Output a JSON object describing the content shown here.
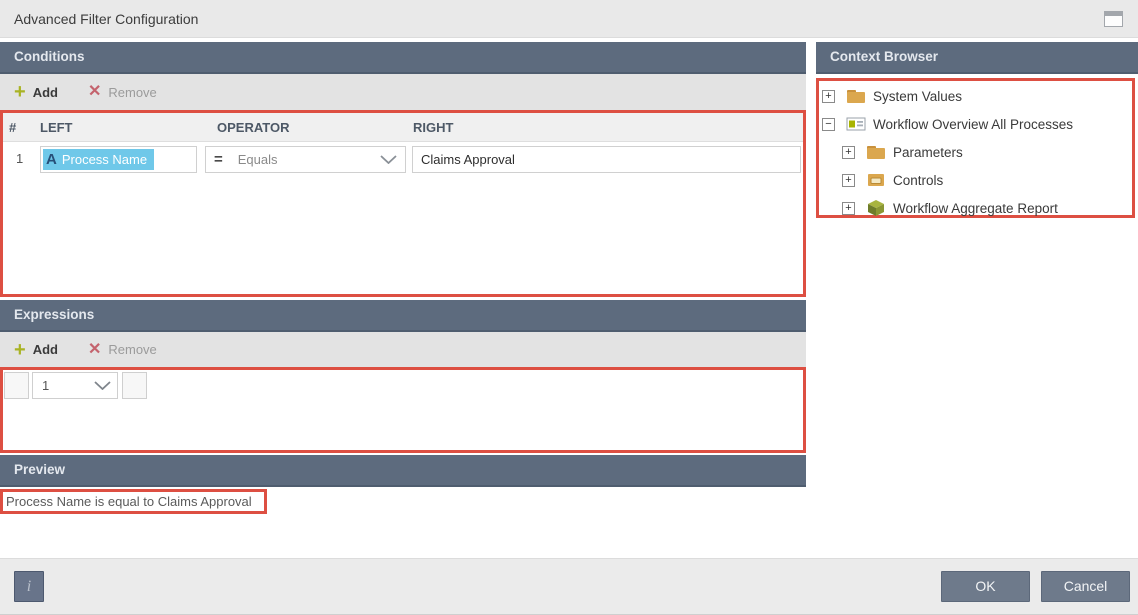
{
  "dialog": {
    "title": "Advanced Filter Configuration",
    "window_icon": "maximize-window-icon"
  },
  "colors": {
    "header_bar": "#5d6b7e",
    "annotation_red": "#dd4f42",
    "token_highlight": "#6fc8e9",
    "add_icon_green": "#a9b324",
    "remove_icon_red": "#c4636d",
    "button_slate": "#6e7a8b"
  },
  "conditions": {
    "header": "Conditions",
    "toolbar": {
      "add_icon": "+",
      "add": "Add",
      "remove_icon": "✕",
      "remove": "Remove"
    },
    "table": {
      "columns": [
        "#",
        "LEFT",
        "OPERATOR",
        "RIGHT"
      ],
      "rows": [
        {
          "num": "1",
          "left_field_icon": "A",
          "left": "Process Name",
          "operator_icon": "=",
          "operator": "Equals",
          "right": "Claims Approval"
        }
      ]
    }
  },
  "expressions": {
    "header": "Expressions",
    "toolbar": {
      "add_icon": "+",
      "add": "Add",
      "remove_icon": "✕",
      "remove": "Remove"
    },
    "row": {
      "order_value": "1"
    }
  },
  "preview": {
    "header": "Preview",
    "text": "Process Name is equal to Claims Approval"
  },
  "context_browser": {
    "header": "Context Browser",
    "tree": [
      {
        "expander": "+",
        "icon": "folder-icon",
        "label": "System Values",
        "level": 0
      },
      {
        "expander": "−",
        "icon": "smartobject-icon",
        "label": "Workflow Overview All Processes",
        "level": 0
      },
      {
        "expander": "+",
        "icon": "folder-icon",
        "label": "Parameters",
        "level": 1
      },
      {
        "expander": "+",
        "icon": "controls-icon",
        "label": "Controls",
        "level": 1
      },
      {
        "expander": "+",
        "icon": "cube-icon",
        "label": "Workflow Aggregate Report",
        "level": 1
      }
    ]
  },
  "footer": {
    "info_label": "i",
    "ok": "OK",
    "cancel": "Cancel"
  }
}
